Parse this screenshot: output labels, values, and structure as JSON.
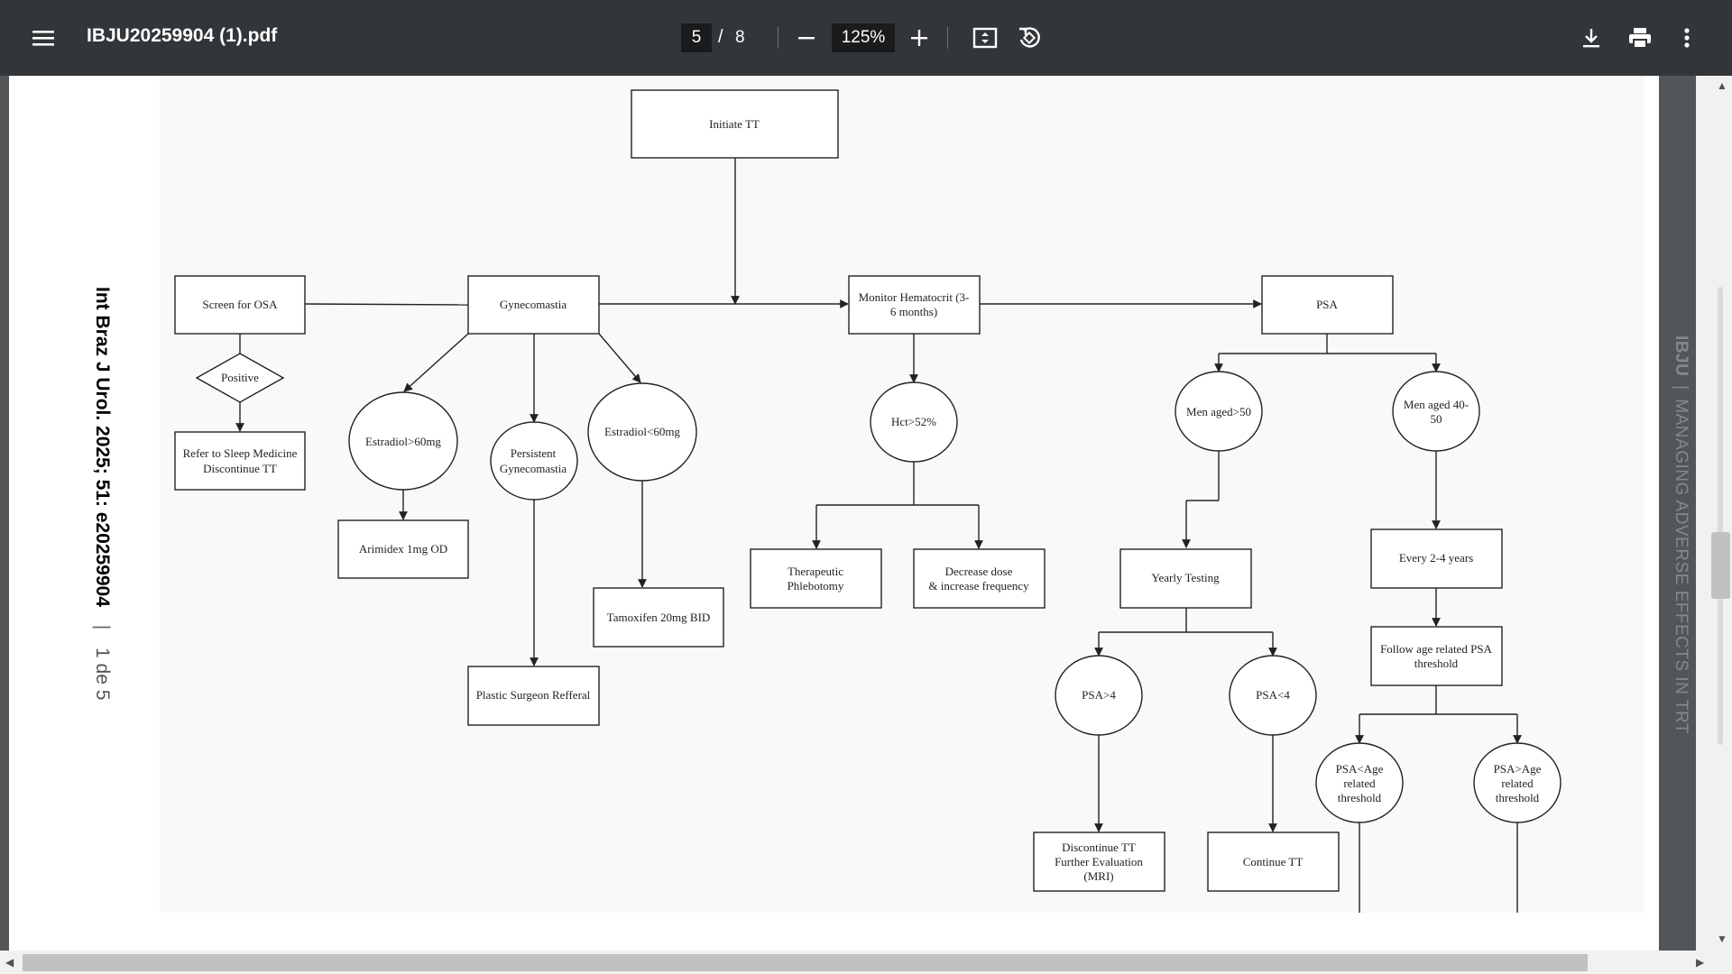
{
  "toolbar": {
    "menu_icon": "hamburger-menu-icon",
    "file_name": "IBJU20259904 (1).pdf",
    "current_page": "5",
    "page_separator": "/",
    "total_pages": "8",
    "zoom_out_icon": "minus-icon",
    "zoom_level": "125%",
    "zoom_in_icon": "plus-icon",
    "fit_icon": "fit-to-page-icon",
    "rotate_icon": "rotate-icon",
    "download_icon": "download-icon",
    "print_icon": "print-icon",
    "more_icon": "more-vert-icon"
  },
  "document": {
    "left_margin_text": "Int Braz J Urol. 2025; 51: e20259904",
    "left_margin_sep": "|",
    "left_margin_page": "1 de 5",
    "right_margin_brand": "IBJU",
    "right_margin_sep": "|",
    "right_margin_text": "MANAGING ADVERSE EFFECTS IN TRT"
  },
  "flowchart": {
    "initiate": "Initiate TT",
    "screen_osa": "Screen for OSA",
    "positive": "Positive",
    "refer_sleep_1": "Refer to Sleep Medicine",
    "refer_sleep_2": "Discontinue TT",
    "gynecomastia": "Gynecomastia",
    "estradiol_high": "Estradiol>60mg",
    "persistent_1": "Persistent",
    "persistent_2": "Gynecomastia",
    "estradiol_low": "Estradiol<60mg",
    "arimidex": "Arimidex 1mg OD",
    "tamoxifen": "Tamoxifen 20mg BID",
    "plastic": "Plastic Surgeon Refferal",
    "monitor_1": "Monitor Hematocrit (3-",
    "monitor_2": "6 months)",
    "hct": "Hct>52%",
    "phleb_1": "Therapeutic",
    "phleb_2": "Phlebotomy",
    "decrease_1": "Decrease dose",
    "decrease_2": "& increase frequency",
    "psa": "PSA",
    "men50": "Men aged>50",
    "men4050_1": "Men aged 40-",
    "men4050_2": "50",
    "yearly": "Yearly Testing",
    "every": "Every 2-4 years",
    "follow_1": "Follow age related PSA",
    "follow_2": "threshold",
    "psa_gt4": "PSA>4",
    "psa_lt4": "PSA<4",
    "psa_lt_age_1": "PSA<Age",
    "psa_lt_age_2": "related",
    "psa_lt_age_3": "threshold",
    "psa_gt_age_1": "PSA>Age",
    "psa_gt_age_2": "related",
    "psa_gt_age_3": "threshold",
    "discontinue_1": "Discontinue TT",
    "discontinue_2": "Further Evaluation",
    "discontinue_3": "(MRI)",
    "continue": "Continue TT"
  }
}
